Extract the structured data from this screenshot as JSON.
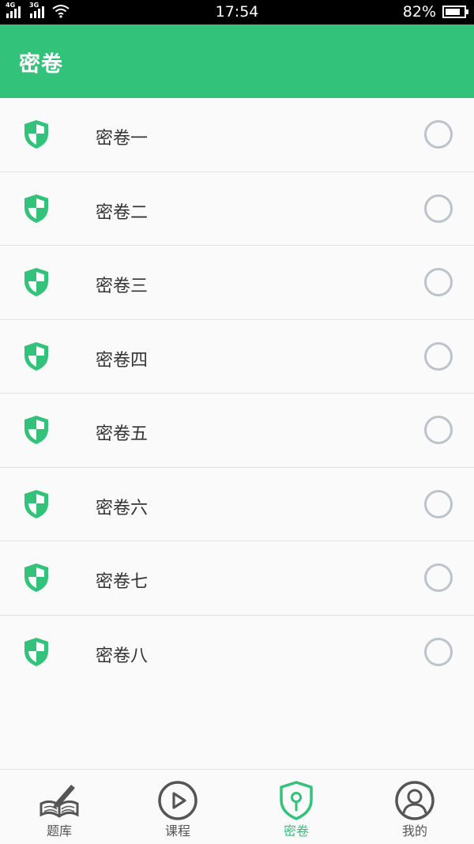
{
  "status_bar": {
    "network_1": "4G",
    "network_2": "3G",
    "time": "17:54",
    "battery_text": "82%",
    "battery_level": 0.82
  },
  "header": {
    "title": "密卷"
  },
  "papers": [
    {
      "label": "密卷一",
      "selected": false
    },
    {
      "label": "密卷二",
      "selected": false
    },
    {
      "label": "密卷三",
      "selected": false
    },
    {
      "label": "密卷四",
      "selected": false
    },
    {
      "label": "密卷五",
      "selected": false
    },
    {
      "label": "密卷六",
      "selected": false
    },
    {
      "label": "密卷七",
      "selected": false
    },
    {
      "label": "密卷八",
      "selected": false
    }
  ],
  "tabs": [
    {
      "label": "题库",
      "icon": "book-pen-icon",
      "active": false
    },
    {
      "label": "课程",
      "icon": "play-circle-icon",
      "active": false
    },
    {
      "label": "密卷",
      "icon": "shield-key-icon",
      "active": true
    },
    {
      "label": "我的",
      "icon": "user-circle-icon",
      "active": false
    }
  ],
  "colors": {
    "accent": "#32c27a",
    "radio_border": "#b9c4cb",
    "tab_icon": "#555555"
  }
}
